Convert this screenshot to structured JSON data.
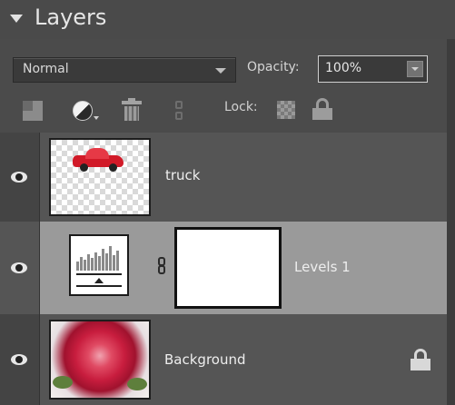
{
  "panel": {
    "title": "Layers",
    "blend_mode": "Normal",
    "opacity_label": "Opacity:",
    "opacity_value": "100%",
    "lock_label": "Lock:"
  },
  "toolbar": {
    "icons": [
      "new-layer-icon",
      "adjustment-layer-icon",
      "trash-icon",
      "link-layers-icon",
      "lock-transparency-icon",
      "lock-all-icon"
    ]
  },
  "layers": [
    {
      "name": "truck",
      "visible": true,
      "thumbnail": "truck-image",
      "selected": false
    },
    {
      "name": "Levels 1",
      "visible": true,
      "thumbnail": "levels-adjustment",
      "mask": "white-mask",
      "selected": true
    },
    {
      "name": "Background",
      "visible": true,
      "thumbnail": "rose-image",
      "locked": true,
      "selected": false
    }
  ],
  "colors": {
    "panel_bg": "#4b4b4b",
    "selected_row": "#9a9a9a",
    "text": "#eeeeee"
  }
}
